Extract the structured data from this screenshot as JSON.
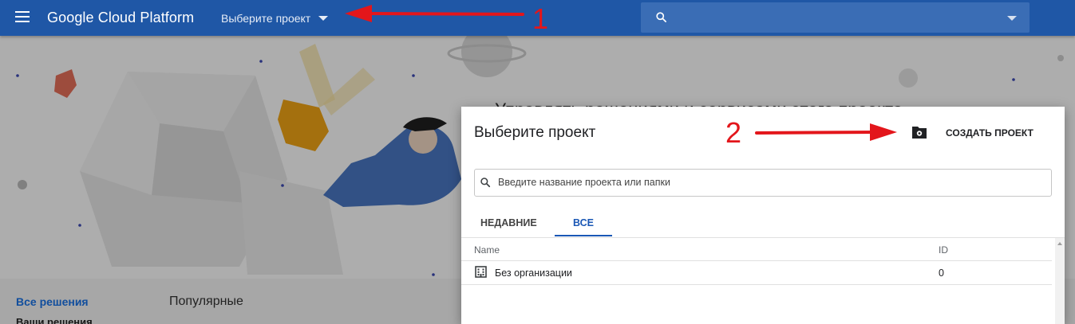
{
  "app": {
    "brand": "Google Cloud Platform",
    "project_picker_label": "Выберите проект",
    "search_placeholder": ""
  },
  "background": {
    "headline": "Управлять решениями и сервисами этого проекта",
    "nav_all_solutions": "Все решения",
    "nav_your_solutions": "Ваши решения",
    "nav_popular": "Популярные"
  },
  "dialog": {
    "title": "Выберите проект",
    "create_project_label": "СОЗДАТЬ ПРОЕКТ",
    "search_placeholder": "Введите название проекта или папки",
    "tabs": [
      {
        "label": "НЕДАВНИЕ",
        "active": false
      },
      {
        "label": "ВСЕ",
        "active": true
      }
    ],
    "table": {
      "columns": [
        "Name",
        "ID"
      ],
      "rows": [
        {
          "icon": "building-icon",
          "name": "Без организации",
          "id": "0"
        }
      ]
    }
  },
  "annotations": {
    "marker_1": "1",
    "marker_2": "2",
    "color": "#e3161b"
  },
  "colors": {
    "topbar": "#1f57a6",
    "accent": "#1a57b5",
    "annotation_red": "#e3161b"
  }
}
